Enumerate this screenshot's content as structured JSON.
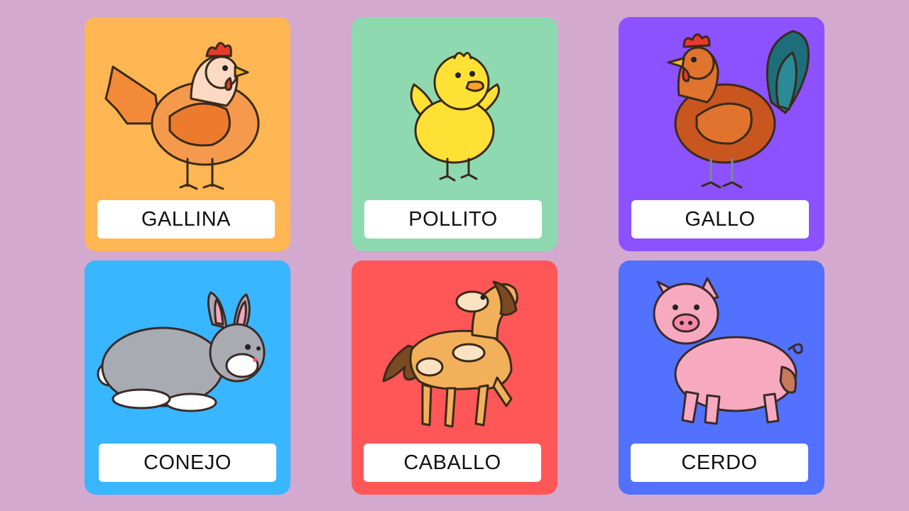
{
  "cards": [
    {
      "label": "GALLINA",
      "color": "#ffb653",
      "animal": "hen-illustration"
    },
    {
      "label": "POLLITO",
      "color": "#8fd9b0",
      "animal": "chick-illustration"
    },
    {
      "label": "GALLO",
      "color": "#8c52ff",
      "animal": "rooster-illustration"
    },
    {
      "label": "CONEJO",
      "color": "#38b6ff",
      "animal": "rabbit-illustration"
    },
    {
      "label": "CABALLO",
      "color": "#ff5757",
      "animal": "horse-illustration"
    },
    {
      "label": "CERDO",
      "color": "#5271ff",
      "animal": "pig-illustration"
    }
  ],
  "background_color": "#d3a9cf"
}
